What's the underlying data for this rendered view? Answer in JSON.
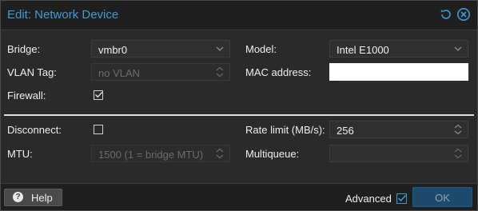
{
  "window": {
    "title": "Edit: Network Device"
  },
  "titlebar_icons": {
    "reset": "reset-icon",
    "close": "close-circle-icon"
  },
  "form": {
    "bridge": {
      "label": "Bridge:",
      "value": "vmbr0"
    },
    "vlan_tag": {
      "label": "VLAN Tag:",
      "placeholder": "no VLAN"
    },
    "firewall": {
      "label": "Firewall:",
      "checked": true
    },
    "model": {
      "label": "Model:",
      "value": "Intel E1000"
    },
    "mac_address": {
      "label": "MAC address:",
      "value_redacted": true
    },
    "disconnect": {
      "label": "Disconnect:",
      "checked": false
    },
    "mtu": {
      "label": "MTU:",
      "placeholder": "1500 (1 = bridge MTU)"
    },
    "rate_limit": {
      "label": "Rate limit (MB/s):",
      "value": "256"
    },
    "multiqueue": {
      "label": "Multiqueue:",
      "value": ""
    }
  },
  "footer": {
    "help_label": "Help",
    "advanced_label": "Advanced",
    "advanced_checked": true,
    "ok_label": "OK"
  },
  "colors": {
    "accent": "#3d9bd6",
    "background": "#2a2a2a",
    "titlebar": "#1f1f1f",
    "ok_button": "#1e4b6d"
  }
}
